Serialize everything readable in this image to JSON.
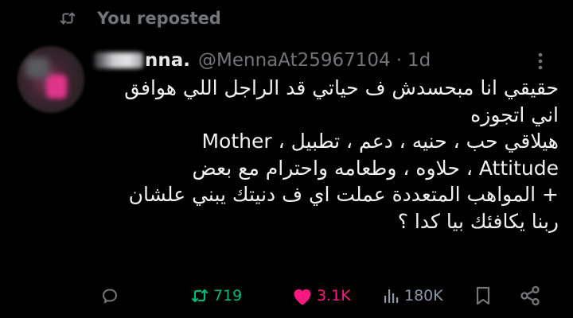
{
  "repost_banner": {
    "text": "You reposted",
    "icon": "repost-icon"
  },
  "tweet": {
    "author_name": "nna.",
    "handle": "@MennaAt25967104",
    "separator": "·",
    "time": "1d",
    "lines": [
      "حقيقي انا مبحسدش ف حياتي قد الراجل اللي هوافق",
      "اني اتجوزه",
      "هيلاقي حب ، حنيه ، دعم ، تطبيل ، Mother",
      "Attitude ، حلاوه ، وطعامه واحترام مع بعض",
      "+ المواهب المتعددة عملت اي ف دنيتك يبني علشان",
      "ربنا يكافئك بيا كدا ؟"
    ]
  },
  "actions": {
    "reply": {
      "icon": "reply-icon"
    },
    "repost": {
      "count": "719",
      "icon": "repost-icon",
      "color": "#00ba7c",
      "active": true
    },
    "like": {
      "count": "3.1K",
      "icon": "heart-icon",
      "color": "#f91880",
      "active": true
    },
    "views": {
      "count": "180K",
      "icon": "views-icon"
    },
    "bookmark": {
      "icon": "bookmark-icon"
    },
    "share": {
      "icon": "share-icon"
    }
  }
}
